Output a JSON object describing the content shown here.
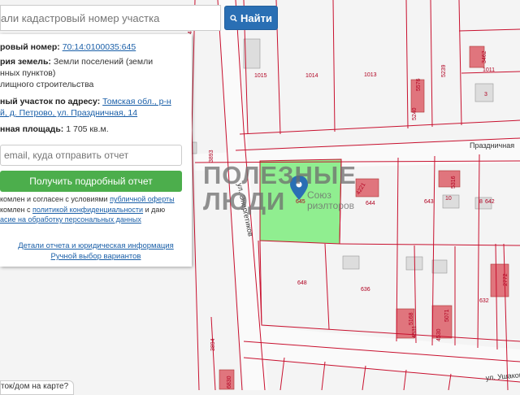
{
  "search": {
    "placeholder": "али кадастровый номер участка",
    "button_label": "Найти"
  },
  "panel": {
    "cadastral_label": "ровый номер:",
    "cadastral_value": "70:14:0100035:645",
    "land_category_label": "рия земель:",
    "land_category_value_1": "Земли поселений (земли",
    "land_category_value_2": "нных пунктов)",
    "land_category_value_3": "лищного строительства",
    "address_label": "ный участок по адресу:",
    "address_value_1": "Томская обл., р-н",
    "address_value_2": "й, д. Петрово, ул. Праздничная, 14",
    "area_label": "нная площадь:",
    "area_value": "1 705 кв.м.",
    "email_placeholder": "email, куда отправить отчет",
    "report_button": "Получить подробный отчет",
    "agree1_prefix": "комлен и согласен с условиями ",
    "agree1_link": "публичной оферты",
    "agree2_prefix": "комлен с ",
    "agree2_link": "политикой конфиденциальности",
    "agree2_suffix": " и даю",
    "agree3_link": "асие на обработку персональных данных",
    "details_link": "Детали отчета и юридическая информация",
    "manual_link": "Ручной выбор вариантов"
  },
  "watermark": {
    "line1": "ПОЛЕЗНЫЕ",
    "line2": "ЛЮДИ",
    "sub1": "Союз",
    "sub2": "риэлторов"
  },
  "map": {
    "streets": {
      "prazdnichnaya": "Праздничная",
      "energetikov": "ул. Энергетиков",
      "ushakova": "ул. Ушаков"
    },
    "plots": {
      "p1015": "1015",
      "p1014": "1014",
      "p1013": "1013",
      "p1011": "1011",
      "p3": "3",
      "p5239": "5239",
      "p5240": "5240",
      "p5576": "5576",
      "p3462": "3462",
      "p642": "642",
      "p643": "643",
      "p644": "644",
      "p645": "645",
      "p648": "648",
      "p636": "636",
      "p632": "632",
      "p10": "10",
      "p5316": "5316",
      "p4221": "4221",
      "p8": "8",
      "p3893": "3893",
      "p3894": "3894",
      "p4531": "4531",
      "p4530": "4530",
      "p5168": "5168",
      "p5071": "5071",
      "p2772": "2772",
      "p6830": "6830",
      "p4452": "4452"
    }
  },
  "tooltip": "ток/дом на карте?",
  "colors": {
    "boundary": "#c8102e",
    "selected_fill": "#90ee90",
    "building_fill": "#e0757d",
    "button_blue": "#2a6fb4",
    "button_green": "#4cae4c",
    "marker": "#2a6fb4"
  }
}
